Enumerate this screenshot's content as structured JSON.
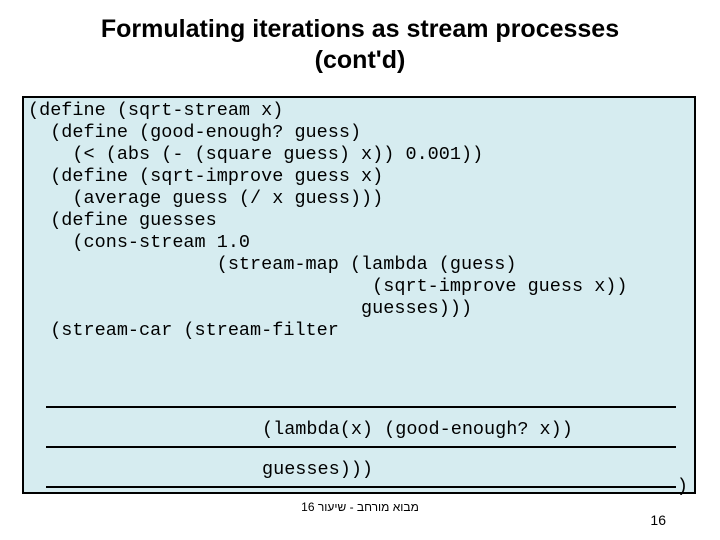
{
  "title_l1": "Formulating iterations as stream processes",
  "title_l2": "(cont'd)",
  "code_main": "(define (sqrt-stream x)\n  (define (good-enough? guess)\n    (< (abs (- (square guess) x)) 0.001))\n  (define (sqrt-improve guess x)\n    (average guess (/ x guess)))\n  (define guesses\n    (cons-stream 1.0\n                 (stream-map (lambda (guess)\n                               (sqrt-improve guess x))\n                              guesses)))\n  (stream-car (stream-filter",
  "fill_line1": "(lambda(x) (good-enough? x))",
  "fill_line2": "guesses)))",
  "trailing_paren": ")",
  "footer_center": "מבוא מורחב - שיעור 16",
  "page_number": "16"
}
